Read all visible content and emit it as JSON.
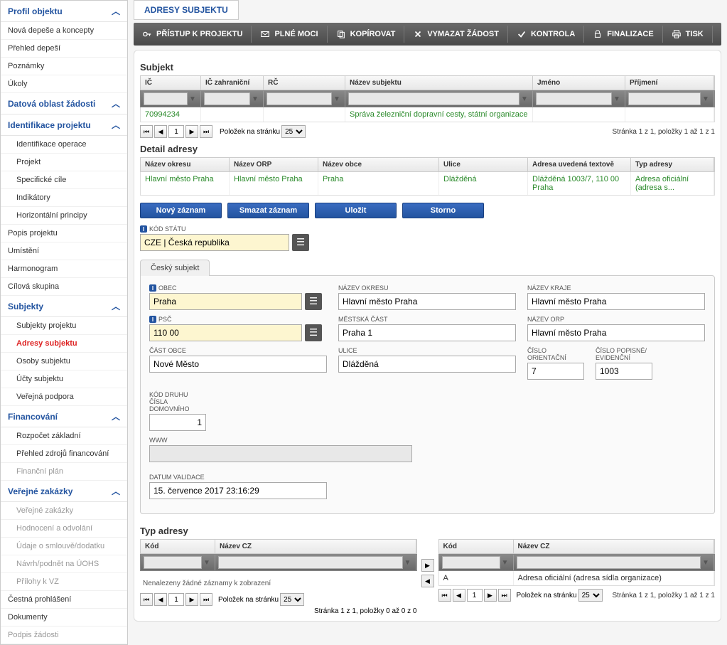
{
  "sidebar": {
    "profil": {
      "title": "Profil objektu",
      "items": [
        "Nová depeše a koncepty",
        "Přehled depeší",
        "Poznámky",
        "Úkoly"
      ]
    },
    "datova": {
      "title": "Datová oblast žádosti"
    },
    "identifikace": {
      "title": "Identifikace projektu",
      "items": [
        "Identifikace operace",
        "Projekt",
        "Specifické cíle",
        "Indikátory",
        "Horizontální principy"
      ]
    },
    "popis": "Popis projektu",
    "umisteni": "Umístění",
    "harmonogram": "Harmonogram",
    "cilova": "Cílová skupina",
    "subjekty": {
      "title": "Subjekty",
      "items": [
        "Subjekty projektu",
        "Adresy subjektu",
        "Osoby subjektu",
        "Účty subjektu",
        "Veřejná podpora"
      ]
    },
    "financovani": {
      "title": "Financování",
      "items": [
        "Rozpočet základní",
        "Přehled zdrojů financování",
        "Finanční plán"
      ]
    },
    "verejne": {
      "title": "Veřejné zakázky",
      "items": [
        "Veřejné zakázky",
        "Hodnocení a odvolání",
        "Údaje o smlouvě/dodatku",
        "Návrh/podnět na ÚOHS",
        "Přílohy k VZ"
      ]
    },
    "cestna": "Čestná prohlášení",
    "dokumenty": "Dokumenty",
    "podpis": "Podpis žádosti"
  },
  "tab_title": "ADRESY SUBJEKTU",
  "toolbar": {
    "pristup": "PŘÍSTUP K PROJEKTU",
    "plne": "PLNÉ MOCI",
    "kopirovat": "KOPÍROVAT",
    "vymazat": "VYMAZAT ŽÁDOST",
    "kontrola": "KONTROLA",
    "finalizace": "FINALIZACE",
    "tisk": "TISK"
  },
  "subjekt": {
    "title": "Subjekt",
    "headers": {
      "ic": "IČ",
      "icz": "IČ zahraniční",
      "rc": "RČ",
      "nazev": "Název subjektu",
      "jmeno": "Jméno",
      "prijmeni": "Příjmení"
    },
    "row": {
      "ic": "70994234",
      "nazev": "Správa železniční dopravní cesty, státní organizace"
    }
  },
  "pager": {
    "label": "Položek na stránku",
    "size": "25",
    "page": "1",
    "info": "Stránka 1 z 1, položky 1 až 1 z 1"
  },
  "detail": {
    "title": "Detail adresy",
    "headers": {
      "okres": "Název okresu",
      "orp": "Název ORP",
      "obec": "Název obce",
      "ulice": "Ulice",
      "text": "Adresa uvedená textově",
      "typ": "Typ adresy"
    },
    "row": {
      "okres": "Hlavní město Praha",
      "orp": "Hlavní město Praha",
      "obec": "Praha",
      "ulice": "Dlážděná",
      "text": "Dlážděná 1003/7, 110 00 Praha",
      "typ": "Adresa oficiální (adresa s..."
    }
  },
  "buttons": {
    "novy": "Nový záznam",
    "smazat": "Smazat záznam",
    "ulozit": "Uložit",
    "storno": "Storno"
  },
  "form": {
    "kod_statu": {
      "label": "KÓD STÁTU",
      "value": "CZE | Česká republika"
    },
    "subtab": "Český subjekt",
    "obec": {
      "label": "OBEC",
      "value": "Praha"
    },
    "nazev_okresu": {
      "label": "NÁZEV OKRESU",
      "value": "Hlavní město Praha"
    },
    "nazev_kraje": {
      "label": "NÁZEV KRAJE",
      "value": "Hlavní město Praha"
    },
    "psc": {
      "label": "PSČ",
      "value": "110 00"
    },
    "mestska_cast": {
      "label": "MĚSTSKÁ ČÁST",
      "value": "Praha 1"
    },
    "nazev_orp": {
      "label": "NÁZEV ORP",
      "value": "Hlavní město Praha"
    },
    "cast_obce": {
      "label": "ČÁST OBCE",
      "value": "Nové Město"
    },
    "ulice": {
      "label": "ULICE",
      "value": "Dlážděná"
    },
    "cislo_or": {
      "label": "ČÍSLO ORIENTAČNÍ",
      "value": "7"
    },
    "cislo_pop": {
      "label": "ČÍSLO POPISNÉ/\nEVIDENČNÍ",
      "value": "1003"
    },
    "kod_druhu": {
      "label": "KÓD DRUHU ČÍSLA\nDOMOVNÍHO",
      "value": "1"
    },
    "www": {
      "label": "WWW",
      "value": ""
    },
    "datum_validace": {
      "label": "DATUM VALIDACE",
      "value": "15. července 2017 23:16:29"
    }
  },
  "typ_adresy": {
    "title": "Typ adresy",
    "headers": {
      "kod": "Kód",
      "nazev": "Název CZ"
    },
    "empty": "Nenalezeny žádné záznamy k zobrazení",
    "right_row": {
      "kod": "A",
      "nazev": "Adresa oficiální (adresa sídla organizace)"
    },
    "pager_left": "Stránka 1 z 1, položky 0 až 0 z 0",
    "pager_right": "Stránka 1 z 1, položky 1 až 1 z 1"
  }
}
